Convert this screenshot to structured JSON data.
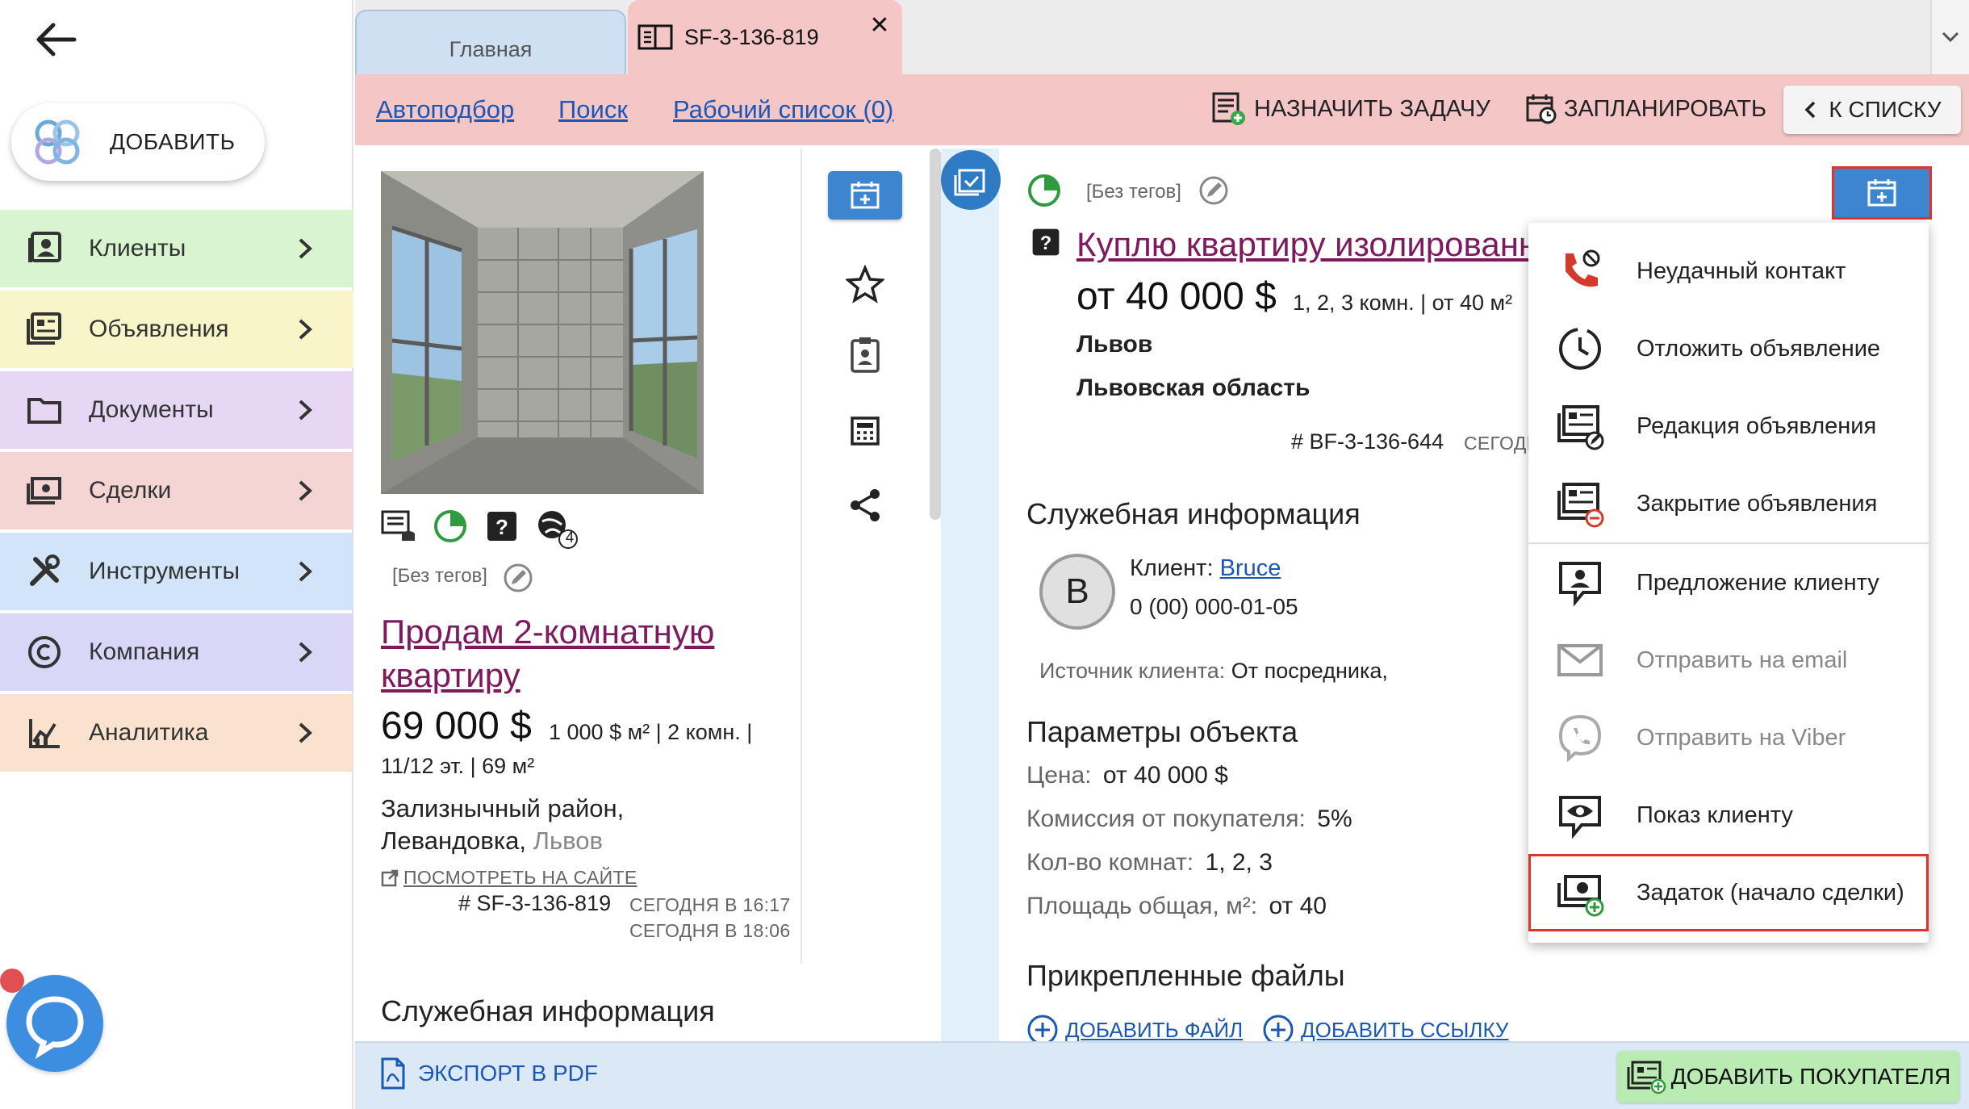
{
  "sidebar": {
    "add_label": "ДОБАВИТЬ",
    "items": [
      {
        "label": "Клиенты",
        "color": "#d9f5d0"
      },
      {
        "label": "Объявления",
        "color": "#f8f6c8"
      },
      {
        "label": "Документы",
        "color": "#e6d7f5"
      },
      {
        "label": "Сделки",
        "color": "#f5d4d4"
      },
      {
        "label": "Инструменты",
        "color": "#d2e5f8"
      },
      {
        "label": "Компания",
        "color": "#d9d6f8"
      },
      {
        "label": "Аналитика",
        "color": "#f9e3cf"
      }
    ]
  },
  "tabs": {
    "home": "Главная",
    "active": "SF-3-136-819"
  },
  "toolbar": {
    "link1": "Автоподбор",
    "link2": "Поиск",
    "link3": "Рабочий список (0)",
    "assign": "НАЗНАЧИТЬ ЗАДАЧУ",
    "plan": "ЗАПЛАНИРОВАТЬ",
    "back": "К СПИСКУ"
  },
  "left_card": {
    "tags": "[Без тегов]",
    "web_count": "4",
    "title_line1": "Продам 2-комнатную",
    "title_line2": "квартиру",
    "price": "69 000 $",
    "meta1": "1 000 $ м² | 2 комн. |",
    "meta2": "11/12 эт. | 69 м²",
    "addr1": "Зализнычный район,",
    "addr2_a": "Левандовка,",
    "addr2_b": "Львов",
    "view_site": "ПОСМОТРЕТЬ НА САЙТЕ",
    "id": "# SF-3-136-819",
    "date1": "СЕГОДНЯ В 16:17",
    "date2": "СЕГОДНЯ В 18:06",
    "section": "Служебная информация"
  },
  "right_card": {
    "tags": "[Без тегов]",
    "title": "Куплю квартиру изолированну",
    "price": "от 40 000 $",
    "meta": "1, 2, 3 комн. | от 40 м²",
    "city": "Львов",
    "region": "Львовская область",
    "id": "# BF-3-136-644",
    "date": "СЕГОДН",
    "service_title": "Служебная информация",
    "avatar": "B",
    "client_label": "Клиент:",
    "client_name": "Bruce",
    "client_phone": "0 (00) 000-01-05",
    "source_label": "Источник клиента:",
    "source_value": "От посредника,",
    "params_title": "Параметры объекта",
    "params": [
      {
        "label": "Цена:",
        "value": "от 40 000 $"
      },
      {
        "label": "Комиссия от покупателя:",
        "value": "5%"
      },
      {
        "label": "Кол-во комнат:",
        "value": "1, 2, 3"
      },
      {
        "label": "Площадь общая, м²:",
        "value": "от 40"
      }
    ],
    "files_title": "Прикрепленные файлы",
    "add_file": "ДОБАВИТЬ ФАЙЛ",
    "add_link": "ДОБАВИТЬ ССЫЛКУ"
  },
  "dropdown": {
    "items": [
      {
        "label": "Неудачный контакт",
        "icon": "failed-call-icon"
      },
      {
        "label": "Отложить объявление",
        "icon": "postpone-icon"
      },
      {
        "label": "Редакция объявления",
        "icon": "edit-listing-icon"
      },
      {
        "label": "Закрытие объявления",
        "icon": "close-listing-icon"
      },
      {
        "label": "Предложение клиенту",
        "icon": "offer-client-icon"
      },
      {
        "label": "Отправить на email",
        "icon": "email-icon"
      },
      {
        "label": "Отправить на Viber",
        "icon": "viber-icon"
      },
      {
        "label": "Показ клиенту",
        "icon": "showing-icon"
      },
      {
        "label": "Задаток (начало сделки)",
        "icon": "deposit-icon"
      }
    ]
  },
  "bottom": {
    "export_pdf": "ЭКСПОРТ В PDF",
    "add_buyer": "ДОБАВИТЬ ПОКУПАТЕЛЯ"
  },
  "colors": {
    "accent_blue": "#3d86cf",
    "pink": "#f5c6c6",
    "link": "#1b57b5",
    "title_link": "#7d1a5e",
    "highlight": "#e0332e"
  }
}
